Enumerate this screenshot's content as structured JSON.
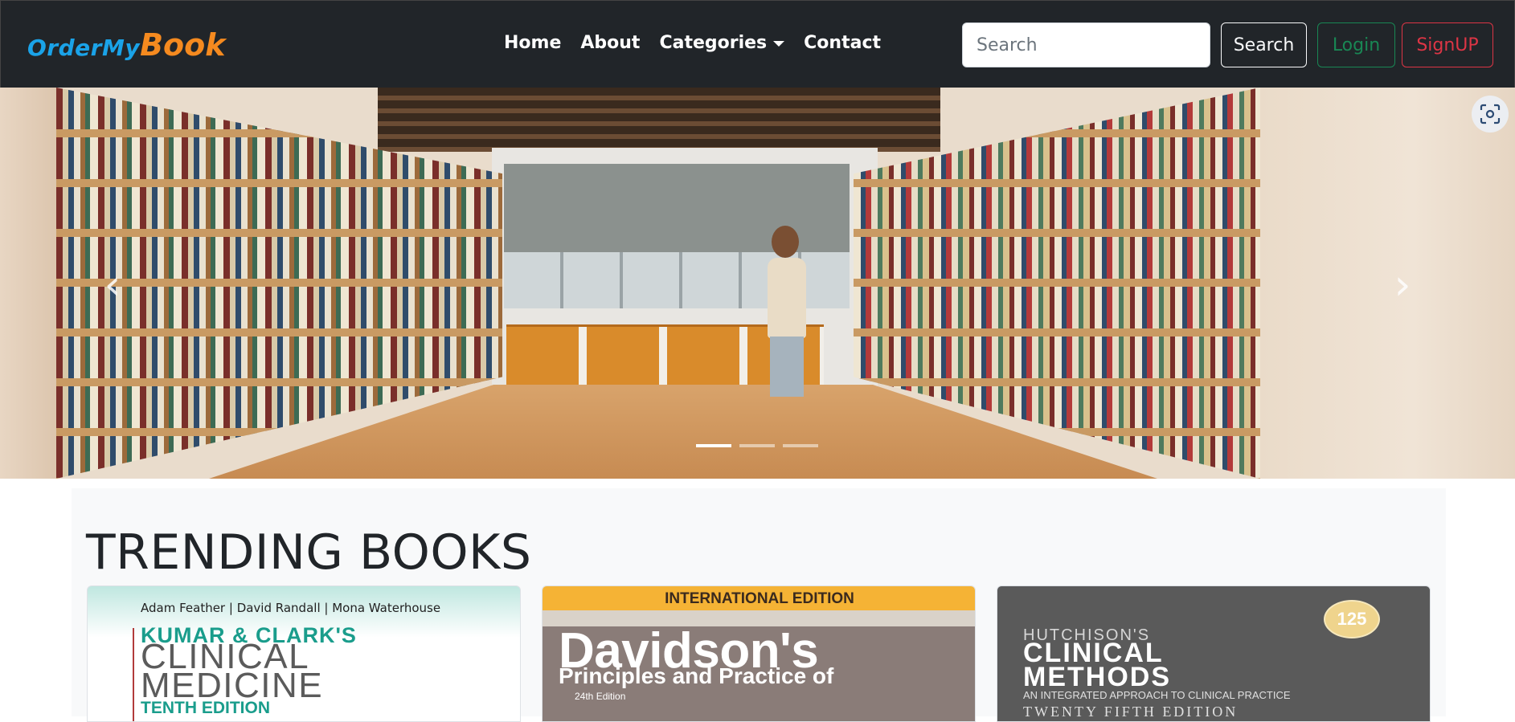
{
  "brand": {
    "part1": "OrderMy",
    "part2": "Book"
  },
  "nav": {
    "items": [
      "Home",
      "About",
      "Categories",
      "Contact"
    ]
  },
  "search": {
    "placeholder": "Search",
    "button_label": "Search"
  },
  "auth": {
    "login_label": "Login",
    "signup_label": "SignUP"
  },
  "carousel": {
    "prev_label": "‹",
    "next_label": "›",
    "indicator_count": 3,
    "active_index": 0
  },
  "trending": {
    "title": "TRENDING BOOKS",
    "books": [
      {
        "authors": "Adam Feather | David Randall | Mona Waterhouse",
        "line1": "KUMAR & CLARK'S",
        "line2": "CLINICAL",
        "line3": "MEDICINE",
        "line4": "TENTH EDITION"
      },
      {
        "band": "INTERNATIONAL EDITION",
        "title": "Davidson's",
        "subtitle": "Principles and Practice of",
        "edition": "24th Edition"
      },
      {
        "badge": "125",
        "line1": "HUTCHISON'S",
        "line2": "CLINICAL",
        "line3": "METHODS",
        "line4": "AN INTEGRATED APPROACH TO CLINICAL PRACTICE",
        "line5": "TWENTY FIFTH EDITION"
      }
    ]
  },
  "colors": {
    "navbar_bg": "#212529",
    "brand_blue": "#1aa3e8",
    "brand_orange": "#f58a1f",
    "login": "#198754",
    "signup": "#dc3545",
    "section_bg": "#f8f9fa"
  },
  "icons": {
    "lens": "visual-search-icon",
    "caret": "caret-down-icon"
  }
}
